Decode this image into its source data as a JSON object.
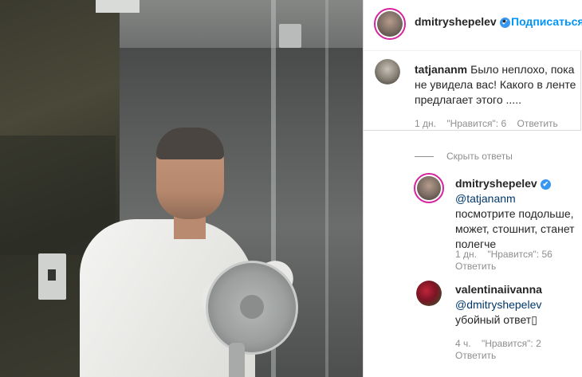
{
  "post": {
    "author": "dmitryshepelev",
    "follow_label": "Подписаться",
    "separator": "•",
    "verified_icon": "✔"
  },
  "comments": [
    {
      "username": "tatjananm",
      "text": "Было неплохо, пока не увидела вас! Какого в ленте предлагает этого .....",
      "time": "1 дн.",
      "likes": "\"Нравится\": 6",
      "reply": "Ответить"
    }
  ],
  "hide_replies_label": "Скрыть ответы",
  "replies": [
    {
      "username": "dmitryshepelev",
      "mention": "@tatjananm",
      "text": " посмотрите подольше, может, стошнит, станет полегче",
      "time": "1 дн.",
      "likes": "\"Нравится\": 56",
      "reply": "Ответить"
    },
    {
      "username": "valentinaiivanna",
      "mention": "@dmitryshepelev",
      "text": "убойный ответ▯",
      "time": "4 ч.",
      "likes": "\"Нравится\": 2",
      "reply": "Ответить"
    }
  ]
}
